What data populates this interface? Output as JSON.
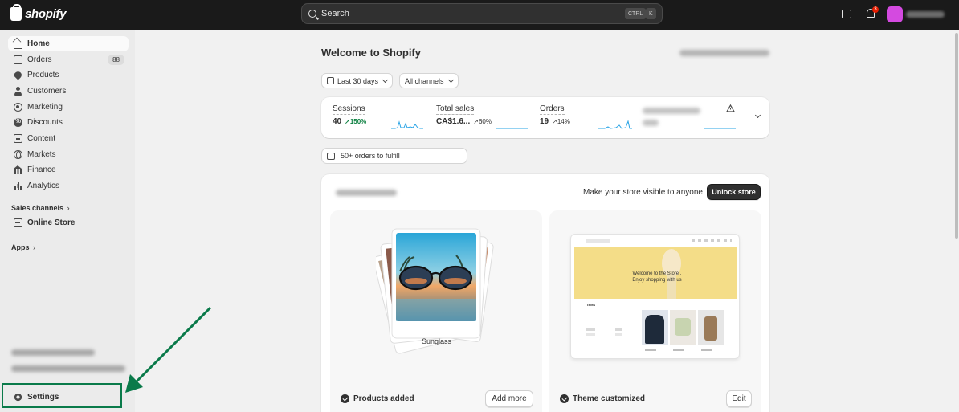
{
  "topbar": {
    "logo_text": "shopify",
    "search_placeholder": "Search",
    "shortcut_keys": [
      "CTRL",
      "K"
    ],
    "notification_count": "3"
  },
  "sidebar": {
    "items": [
      {
        "label": "Home",
        "icon": "home-icon",
        "active": true
      },
      {
        "label": "Orders",
        "icon": "orders-icon",
        "count": "88"
      },
      {
        "label": "Products",
        "icon": "tag-icon"
      },
      {
        "label": "Customers",
        "icon": "person-icon"
      },
      {
        "label": "Marketing",
        "icon": "target-icon"
      },
      {
        "label": "Discounts",
        "icon": "discount-icon"
      },
      {
        "label": "Content",
        "icon": "content-icon"
      },
      {
        "label": "Markets",
        "icon": "globe-icon"
      },
      {
        "label": "Finance",
        "icon": "bank-icon"
      },
      {
        "label": "Analytics",
        "icon": "bar-chart-icon"
      }
    ],
    "sales_channels_label": "Sales channels",
    "online_store_label": "Online Store",
    "apps_label": "Apps",
    "settings_label": "Settings"
  },
  "main": {
    "title": "Welcome to Shopify",
    "date_filter": "Last 30 days",
    "channel_filter": "All channels",
    "metrics": [
      {
        "label": "Sessions",
        "value": "40",
        "trend": "150%",
        "trend_color": "#0a7f3f"
      },
      {
        "label": "Total sales",
        "value": "CA$1.6...",
        "trend": "60%"
      },
      {
        "label": "Orders",
        "value": "19",
        "trend": "14%"
      }
    ],
    "fulfill_label": "50+ orders to fulfill",
    "visibility_text": "Make your store visible to anyone",
    "unlock_button": "Unlock store",
    "product_card": {
      "image_label": "Sunglass",
      "status": "Products added",
      "button": "Add more"
    },
    "theme_card": {
      "preview_heading": "Welcome to the Store ,\nEnjoy shopping with us",
      "preview_section": "ITEMS",
      "status": "Theme customized",
      "button": "Edit"
    }
  },
  "annotation": {
    "color": "#0a7a4a"
  },
  "colors": {
    "topbar": "#1a1a1a",
    "sidebar": "#ebebeb",
    "background": "#f1f1f1",
    "sparkline": "#2aa4e6",
    "dark_button": "#303030"
  }
}
